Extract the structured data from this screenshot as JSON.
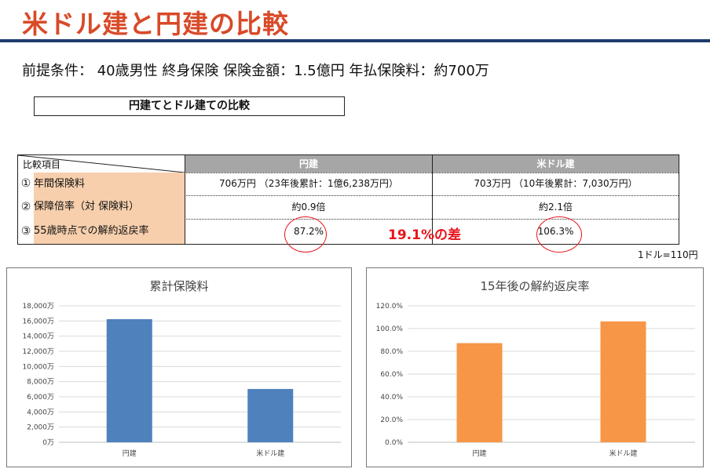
{
  "title": "米ドル建と円建の比較",
  "premise": "前提条件：  40歳男性   終身保険   保険金額：1.5億円   年払保険料：約700万",
  "compare_heading": "円建てとドル建ての比較",
  "table": {
    "corner_label": "比較項目",
    "col_yen": "円建",
    "col_usd": "米ドル建",
    "rows": [
      {
        "num": "①",
        "label": "年間保険料",
        "yen": "706万円  （23年後累計：1億6,238万円）",
        "usd": "703万円  （10年後累計：7,030万円）"
      },
      {
        "num": "②",
        "label": "保障倍率（対  保険料）",
        "yen": "約0.9倍",
        "usd": "約2.1倍"
      },
      {
        "num": "③",
        "label": "55歳時点での解約返戻率",
        "yen": "87.2%",
        "usd": "106.3%"
      }
    ],
    "diff_note": "19.1%の差",
    "rate_note": "1ドル=110円"
  },
  "chart_data": [
    {
      "type": "bar",
      "title": "累計保険料",
      "categories": [
        "円建",
        "米ドル建"
      ],
      "values": [
        16238,
        7030
      ],
      "ylim": [
        0,
        18000
      ],
      "yticks": [
        "0万",
        "2,000万",
        "4,000万",
        "6,000万",
        "8,000万",
        "10,000万",
        "12,000万",
        "14,000万",
        "16,000万",
        "18,000万"
      ],
      "tick_step": 2000,
      "color": "#4f81bd",
      "grid": true
    },
    {
      "type": "bar",
      "title": "15年後の解約返戻率",
      "categories": [
        "円建",
        "米ドル建"
      ],
      "values": [
        87.2,
        106.3
      ],
      "ylim": [
        0,
        120
      ],
      "yticks": [
        "0.0%",
        "20.0%",
        "40.0%",
        "60.0%",
        "80.0%",
        "100.0%",
        "120.0%"
      ],
      "tick_step": 20,
      "color": "#f79646",
      "grid": true
    }
  ]
}
